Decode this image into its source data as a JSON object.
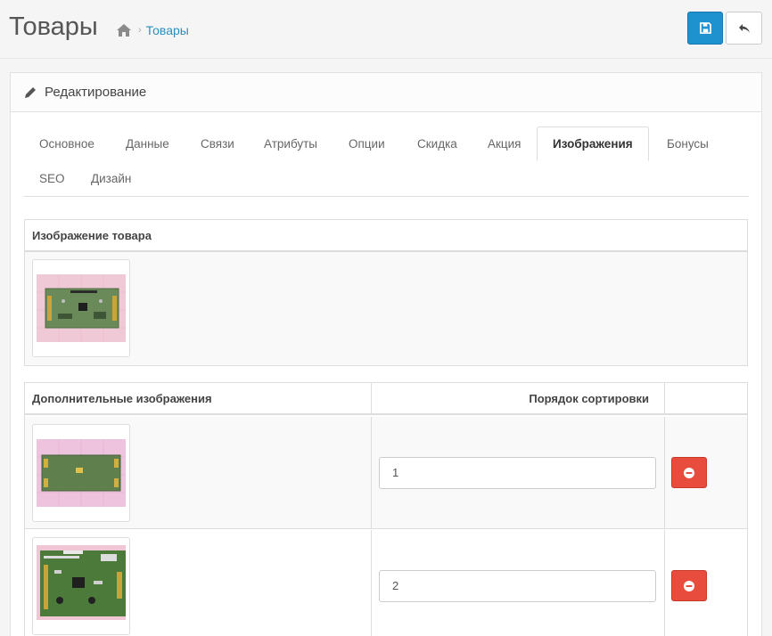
{
  "header": {
    "title": "Товары",
    "breadcrumb": {
      "home_icon": "home-icon",
      "current": "Товары"
    },
    "buttons": {
      "save_icon": "floppy-disk-icon",
      "back_icon": "reply-arrow-icon"
    }
  },
  "panel": {
    "icon": "pencil-icon",
    "title": "Редактирование"
  },
  "tabs": [
    {
      "label": "Основное",
      "active": false
    },
    {
      "label": "Данные",
      "active": false
    },
    {
      "label": "Связи",
      "active": false
    },
    {
      "label": "Атрибуты",
      "active": false
    },
    {
      "label": "Опции",
      "active": false
    },
    {
      "label": "Скидка",
      "active": false
    },
    {
      "label": "Акция",
      "active": false
    },
    {
      "label": "Изображения",
      "active": true
    },
    {
      "label": "Бонусы",
      "active": false
    },
    {
      "label": "SEO",
      "active": false
    },
    {
      "label": "Дизайн",
      "active": false
    }
  ],
  "main_image": {
    "heading": "Изображение товара"
  },
  "additional_images": {
    "col_image": "Дополнительные изображения",
    "col_sort": "Порядок сортировки",
    "rows": [
      {
        "sort_order": "1",
        "remove_icon": "minus-circle-icon"
      },
      {
        "sort_order": "2",
        "remove_icon": "minus-circle-icon"
      }
    ]
  },
  "colors": {
    "primary": "#1e91cf",
    "danger": "#e74c3c",
    "link": "#2a8fbd"
  }
}
